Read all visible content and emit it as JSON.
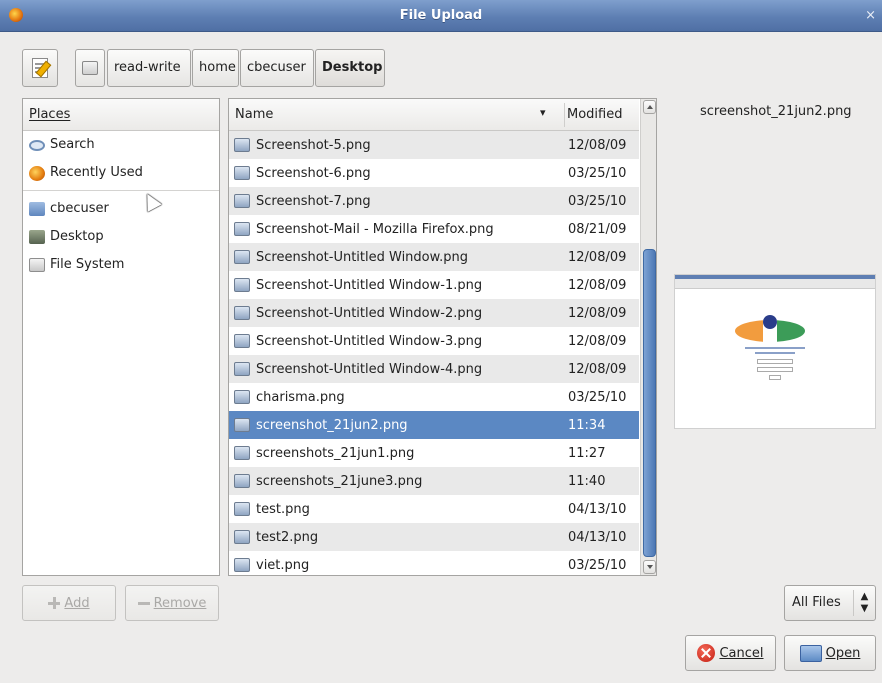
{
  "window": {
    "title": "File Upload",
    "close_glyph": "×",
    "app_icon": "firefox-icon"
  },
  "pathbar": {
    "toggle_icon": "edit-location-icon",
    "crumbs": [
      {
        "label": "read-write",
        "icon": "drive-icon"
      },
      {
        "label": "home"
      },
      {
        "label": "cbecuser"
      },
      {
        "label": "Desktop",
        "active": true
      }
    ]
  },
  "places": {
    "header": "Places",
    "items": [
      {
        "label": "Search",
        "icon": "search-icon"
      },
      {
        "label": "Recently Used",
        "icon": "recent-icon"
      },
      {
        "label": "cbecuser",
        "icon": "home-folder-icon"
      },
      {
        "label": "Desktop",
        "icon": "desktop-icon"
      },
      {
        "label": "File System",
        "icon": "filesystem-icon"
      }
    ]
  },
  "files": {
    "columns": {
      "name": "Name",
      "modified": "Modified"
    },
    "rows": [
      {
        "name": "Screenshot-5.png",
        "modified": "12/08/09"
      },
      {
        "name": "Screenshot-6.png",
        "modified": "03/25/10"
      },
      {
        "name": "Screenshot-7.png",
        "modified": "03/25/10"
      },
      {
        "name": "Screenshot-Mail - Mozilla Firefox.png",
        "modified": "08/21/09"
      },
      {
        "name": "Screenshot-Untitled Window.png",
        "modified": "12/08/09"
      },
      {
        "name": "Screenshot-Untitled Window-1.png",
        "modified": "12/08/09"
      },
      {
        "name": "Screenshot-Untitled Window-2.png",
        "modified": "12/08/09"
      },
      {
        "name": "Screenshot-Untitled Window-3.png",
        "modified": "12/08/09"
      },
      {
        "name": "Screenshot-Untitled Window-4.png",
        "modified": "12/08/09"
      },
      {
        "name": "charisma.png",
        "modified": "03/25/10"
      },
      {
        "name": "screenshot_21jun2.png",
        "modified": "11:34",
        "selected": true
      },
      {
        "name": "screenshots_21jun1.png",
        "modified": "11:27"
      },
      {
        "name": "screenshots_21june3.png",
        "modified": "11:40"
      },
      {
        "name": "test.png",
        "modified": "04/13/10"
      },
      {
        "name": "test2.png",
        "modified": "04/13/10"
      },
      {
        "name": "viet.png",
        "modified": "03/25/10"
      }
    ]
  },
  "preview": {
    "filename": "screenshot_21jun2.png"
  },
  "buttons": {
    "add": "Add",
    "remove": "Remove",
    "cancel": "Cancel",
    "open": "Open"
  },
  "filter": {
    "selected": "All Files"
  },
  "colors": {
    "selection": "#5b88c3",
    "titlebar": "#5e7fb3"
  }
}
